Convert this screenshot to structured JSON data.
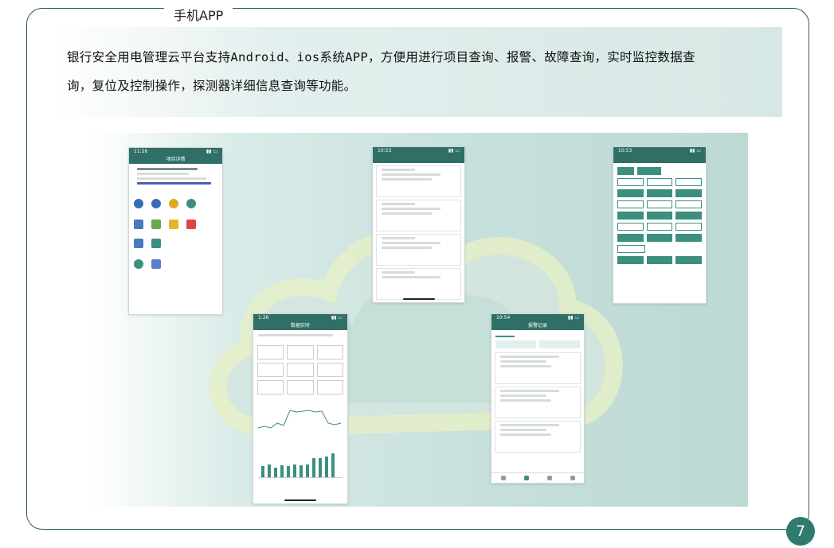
{
  "section": {
    "title": "手机APP"
  },
  "description": {
    "line1": "银行安全用电管理云平台支持Android、ios系统APP，方便用进行项目查询、报警、故障查询，实时监控数据查",
    "line2": "询，复位及控制操作，探测器详细信息查询等功能。"
  },
  "page_number": "7",
  "screenshots": [
    {
      "name": "project-detail-screen",
      "title": "项目详情"
    },
    {
      "name": "detector-list-screen",
      "title": ""
    },
    {
      "name": "detector-detail-screen",
      "title": ""
    },
    {
      "name": "realtime-monitor-screen",
      "title": "数据实时"
    },
    {
      "name": "alarm-records-screen",
      "title": "报警记录"
    }
  ],
  "colors": {
    "frame": "#2e5e57",
    "accent": "#2f7b6f",
    "app_header": "#2f6f66"
  }
}
